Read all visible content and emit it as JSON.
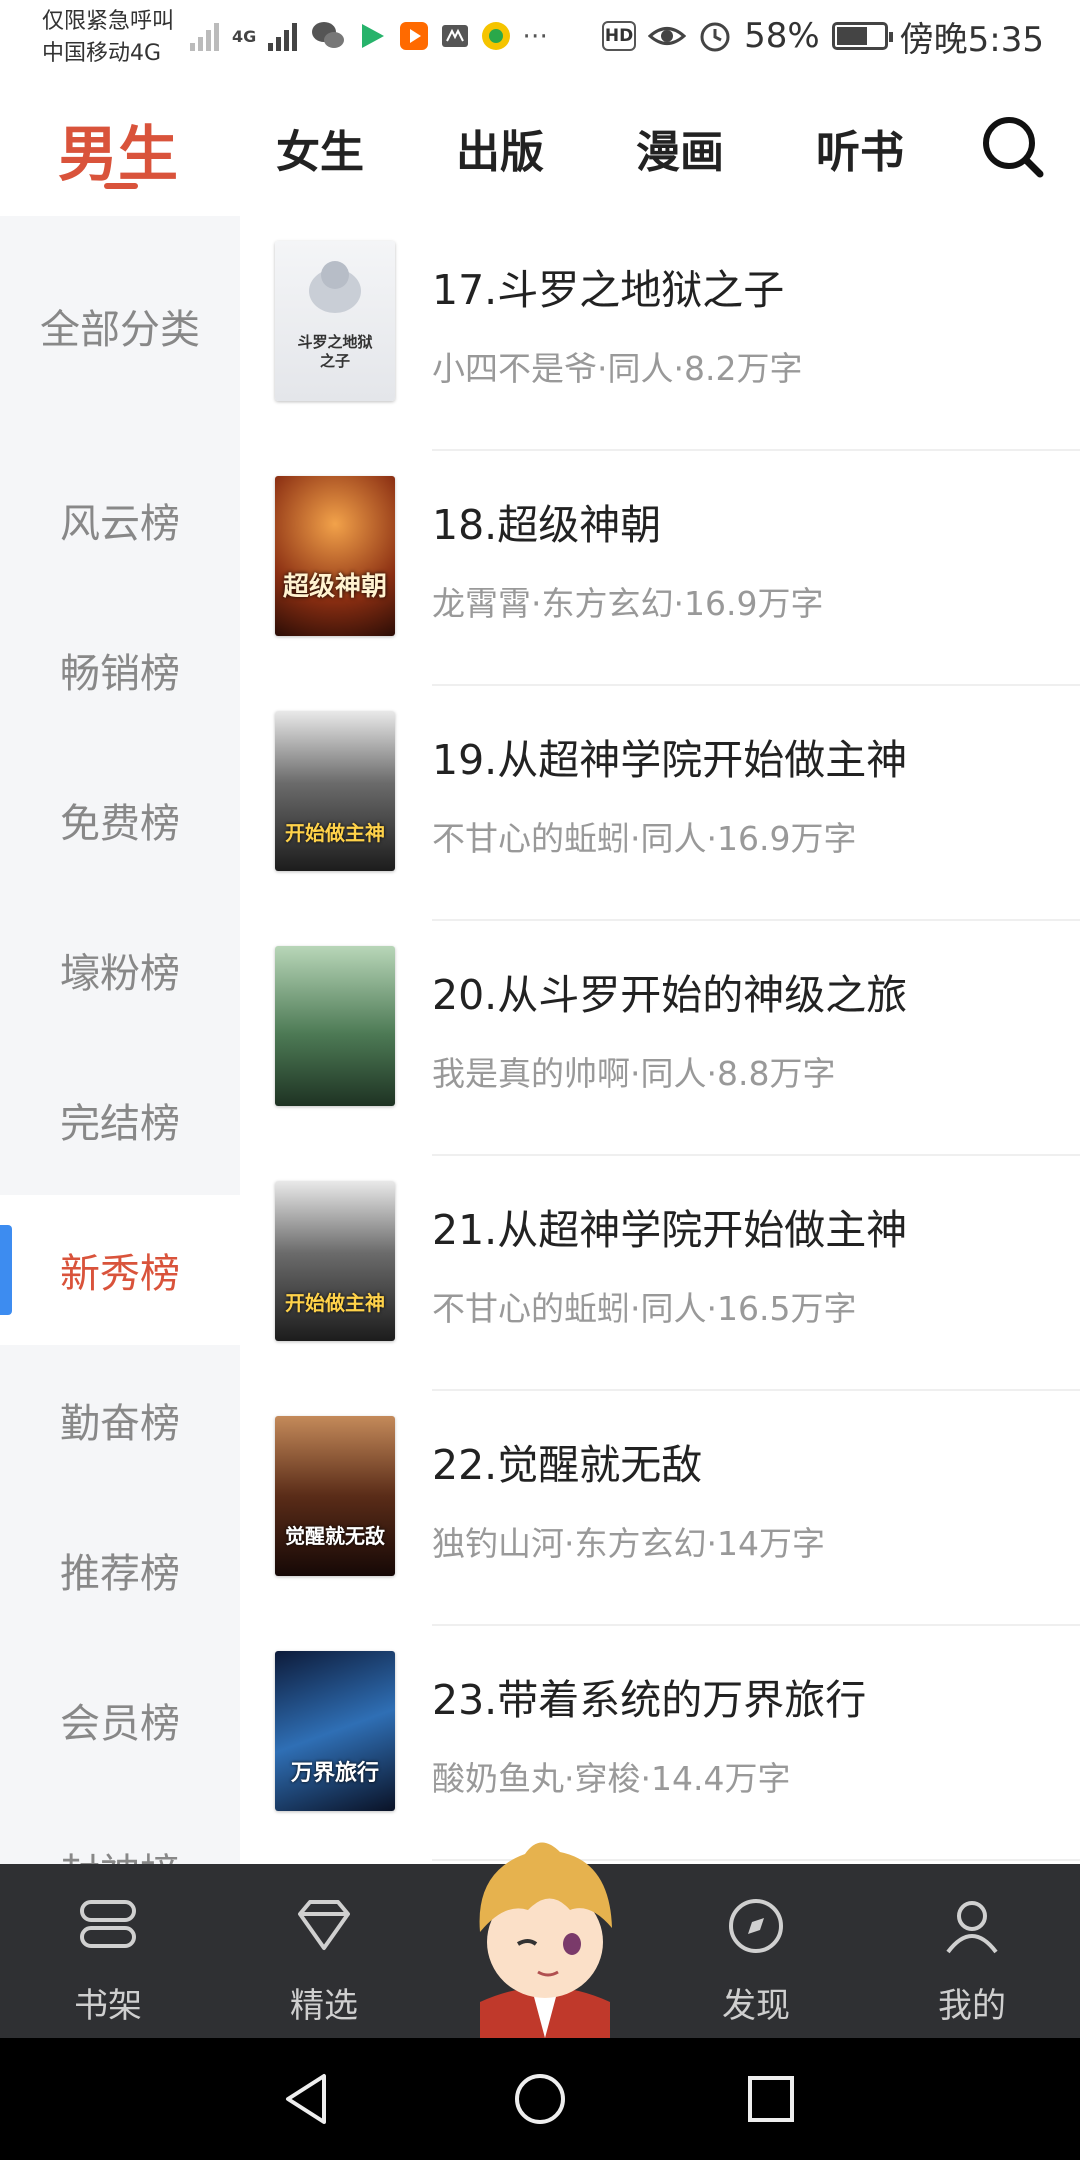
{
  "status_bar": {
    "carrier_line1": "仅限紧急呼叫",
    "carrier_line2": "中国移动4G",
    "network_label": "4G",
    "battery": "58%",
    "time": "傍晚5:35"
  },
  "top_tabs": [
    {
      "label": "男生",
      "active": true
    },
    {
      "label": "女生",
      "active": false
    },
    {
      "label": "出版",
      "active": false
    },
    {
      "label": "漫画",
      "active": false
    },
    {
      "label": "听书",
      "active": false
    }
  ],
  "sidebar": {
    "items": [
      {
        "label": "全部分类"
      },
      {
        "label": "风云榜"
      },
      {
        "label": "畅销榜"
      },
      {
        "label": "免费榜"
      },
      {
        "label": "壕粉榜"
      },
      {
        "label": "完结榜"
      },
      {
        "label": "新秀榜",
        "active": true
      },
      {
        "label": "勤奋榜"
      },
      {
        "label": "推荐榜"
      },
      {
        "label": "会员榜"
      },
      {
        "label": "封神榜"
      }
    ]
  },
  "books": [
    {
      "title": "17.斗罗之地狱之子",
      "meta": "小四不是爷·同人·8.2万字",
      "cover_text": "斗罗之地狱之子"
    },
    {
      "title": "18.超级神朝",
      "meta": "龙霄霄·东方玄幻·16.9万字",
      "cover_text": "超级神朝"
    },
    {
      "title": "19.从超神学院开始做主神",
      "meta": "不甘心的蚯蚓·同人·16.9万字",
      "cover_text": "开始做主神"
    },
    {
      "title": "20.从斗罗开始的神级之旅",
      "meta": "我是真的帅啊·同人·8.8万字",
      "cover_text": ""
    },
    {
      "title": "21.从超神学院开始做主神",
      "meta": "不甘心的蚯蚓·同人·16.5万字",
      "cover_text": "开始做主神"
    },
    {
      "title": "22.觉醒就无敌",
      "meta": "独钓山河·东方玄幻·14万字",
      "cover_text": "觉醒就无敌"
    },
    {
      "title": "23.带着系统的万界旅行",
      "meta": "酸奶鱼丸·穿梭·14.4万字",
      "cover_text": "万界旅行"
    }
  ],
  "bottom_tabs": [
    {
      "label": "书架",
      "icon": "bookshelf-icon"
    },
    {
      "label": "精选",
      "icon": "diamond-icon"
    },
    {
      "label": "发现",
      "icon": "compass-icon"
    },
    {
      "label": "我的",
      "icon": "person-icon"
    }
  ],
  "colors": {
    "accent": "#d9533b",
    "sidebar_indicator": "#3d8cf0",
    "sidebar_bg": "#f5f6f8",
    "bottom_bar_bg": "#2f3033"
  }
}
